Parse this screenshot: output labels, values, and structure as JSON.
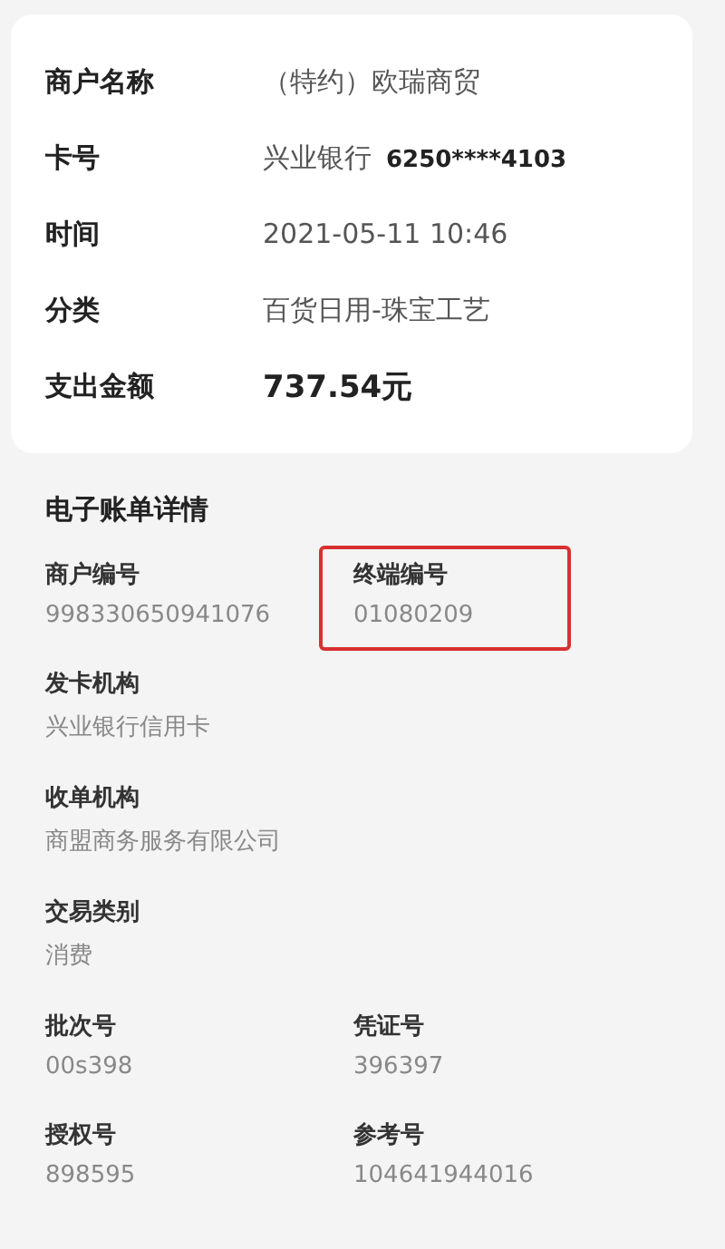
{
  "summary": [
    {
      "label": "商户名称",
      "value": [
        {
          "text": "（特约）欧瑞商贸",
          "bold": false
        }
      ]
    },
    {
      "label": "卡号",
      "value": [
        {
          "text": "兴业银行",
          "bold": false
        },
        {
          "text": "6250****4103",
          "bold": true
        }
      ]
    },
    {
      "label": "时间",
      "value": [
        {
          "text": "2021-05-11  10:46",
          "bold": false
        }
      ]
    },
    {
      "label": "分类",
      "value": [
        {
          "text": "百货日用-珠宝工艺",
          "bold": false
        }
      ]
    },
    {
      "label": "支出金额",
      "value": [
        {
          "text": "737.54元",
          "bold": true
        }
      ]
    }
  ],
  "details": {
    "title": "电子账单详情",
    "rows": [
      [
        {
          "label": "商户编号",
          "value": "998330650941076",
          "highlighted": false
        },
        {
          "label": "终端编号",
          "value": "01080209",
          "highlighted": true
        }
      ],
      [
        {
          "label": "发卡机构",
          "value": "兴业银行信用卡",
          "highlighted": false
        }
      ],
      [
        {
          "label": "收单机构",
          "value": "商盟商务服务有限公司",
          "highlighted": false
        }
      ],
      [
        {
          "label": "交易类别",
          "value": "消费",
          "highlighted": false
        }
      ],
      [
        {
          "label": "批次号",
          "value": "00s398",
          "highlighted": false
        },
        {
          "label": "凭证号",
          "value": "396397",
          "highlighted": false
        }
      ],
      [
        {
          "label": "授权号",
          "value": "898595",
          "highlighted": false
        },
        {
          "label": "参考号",
          "value": "104641944016",
          "highlighted": false
        }
      ]
    ]
  }
}
